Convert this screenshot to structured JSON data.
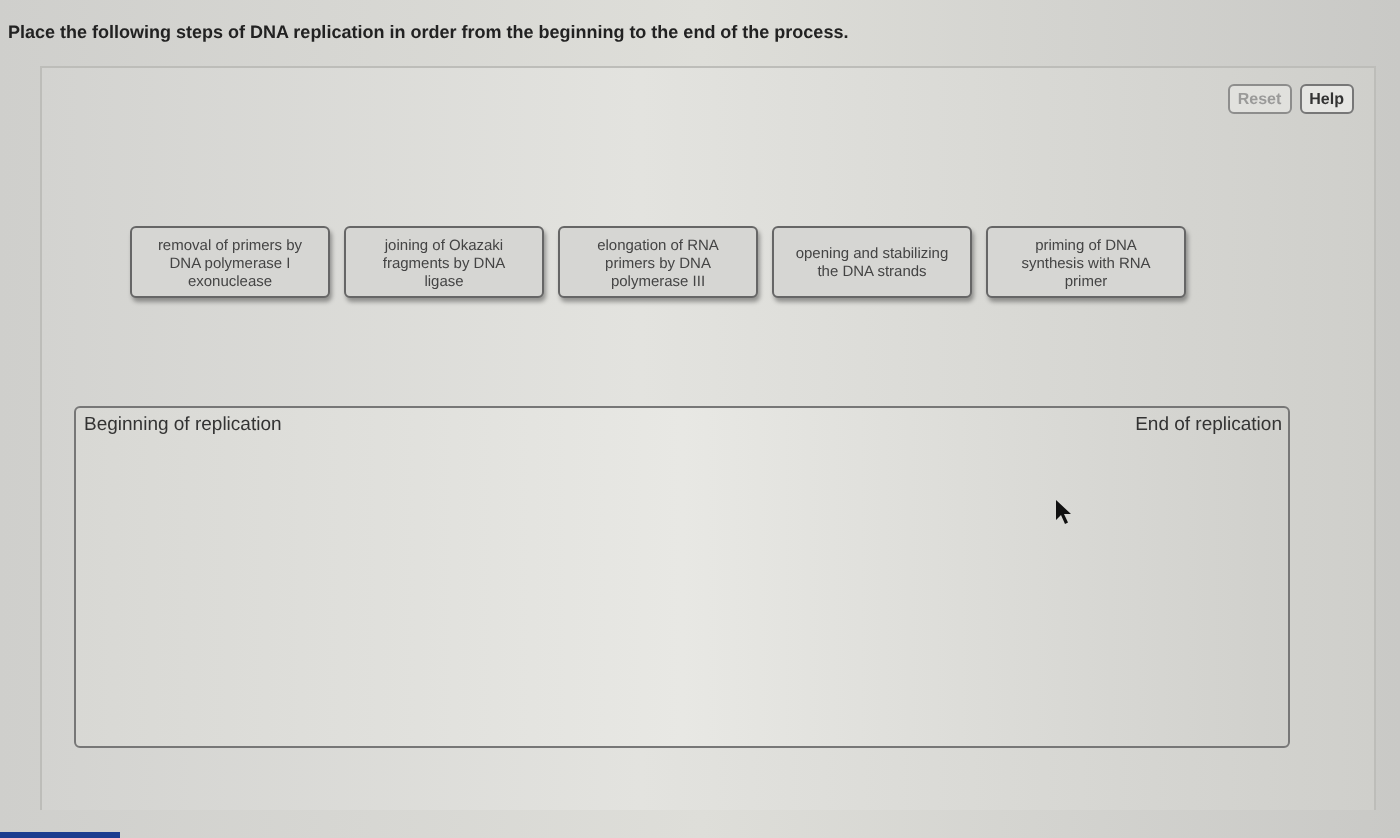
{
  "instruction": "Place the following steps of DNA replication in order from the beginning to the end of the process.",
  "buttons": [
    {
      "label": "Reset",
      "disabled": true
    },
    {
      "label": "Help",
      "disabled": false
    }
  ],
  "cards": [
    "removal of primers by DNA polymerase I exonuclease",
    "joining of Okazaki fragments by DNA ligase",
    "elongation of RNA primers by DNA polymerase III",
    "opening and stabilizing the DNA strands",
    "priming of DNA synthesis with RNA primer"
  ],
  "drop_zone": {
    "start_label": "Beginning of replication",
    "end_label": "End of replication"
  }
}
